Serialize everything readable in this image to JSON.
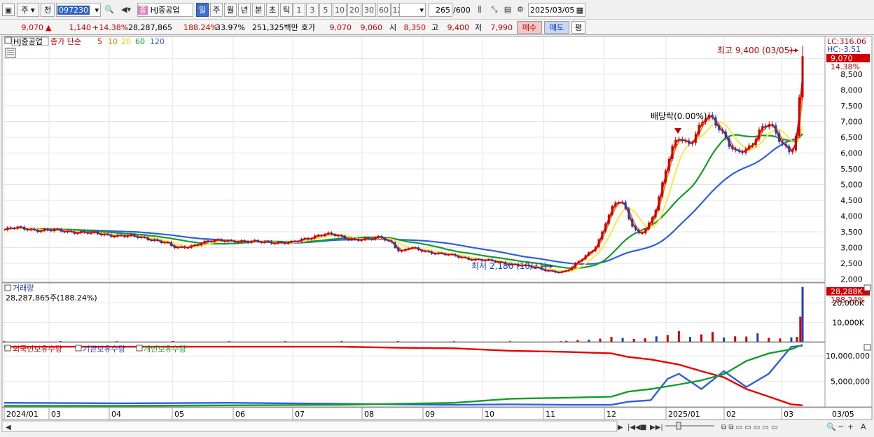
{
  "toolbar": {
    "market_label": "주",
    "prev_label": "전",
    "code": "097230",
    "jong_label": "종",
    "stock_name": "HJ중공업",
    "periods": [
      "일",
      "주",
      "월",
      "년",
      "분",
      "초",
      "틱"
    ],
    "active_period": "일",
    "nums": [
      "1",
      "3",
      "5",
      "10",
      "20",
      "30",
      "60",
      "120"
    ],
    "count": "265",
    "count_max": "/600",
    "date": "2025/03/05"
  },
  "quote": {
    "price": "9,070",
    "arrow": "▲",
    "change": "1,140",
    "change_pct": "+14.38%",
    "volume": "28,287,865",
    "vol_ratio": "188.24%",
    "turnover": "33.97%",
    "amount": "251,325백만",
    "hoga_label": "호가",
    "ask": "9,070",
    "bid": "9,060",
    "open_label": "시",
    "open": "8,350",
    "high_label": "고",
    "high": "9,400",
    "low_label": "저",
    "low": "7,990",
    "buy_label": "매수",
    "sell_label": "매도",
    "avg_label": "평"
  },
  "colors": {
    "up": "#d20000",
    "down": "#1f3dbf",
    "ma5": "#e80000",
    "ma10": "#f08000",
    "ma20": "#f6e84a",
    "ma60": "#169c2a",
    "ma120": "#2f5fe0"
  },
  "chart_data": [
    {
      "type": "candlestick",
      "legend": {
        "name": "HJ중공업",
        "ma_label": "종가 단순",
        "ma_periods": [
          "5",
          "10",
          "20",
          "60",
          "120"
        ]
      },
      "ylim": [
        1900,
        9700
      ],
      "y_ticks": [
        "9,000",
        "8,500",
        "8,000",
        "7,500",
        "7,000",
        "6,500",
        "6,000",
        "5,500",
        "5,000",
        "4,500",
        "4,000",
        "3,500",
        "3,000",
        "2,500",
        "2,000"
      ],
      "y_tick_values": [
        9000,
        8500,
        8000,
        7500,
        7000,
        6500,
        6000,
        5500,
        5000,
        4500,
        4000,
        3500,
        3000,
        2500,
        2000
      ],
      "right_labels": {
        "lc": "LC:316.06",
        "hc": "HC:-3.51",
        "price": "9,070",
        "pct": "14.38%"
      },
      "annotations": {
        "high": "최고 9,400 (03/05)",
        "low": "최저 2,180 (10/31)",
        "dividend": "배당락(0.00%)"
      },
      "high_value": 9400,
      "low_value": 2180,
      "close_series": [
        [
          0,
          3560
        ],
        [
          10,
          3620
        ],
        [
          20,
          3600
        ],
        [
          30,
          3560
        ],
        [
          40,
          3540
        ],
        [
          55,
          3520
        ],
        [
          65,
          3500
        ],
        [
          75,
          3460
        ],
        [
          85,
          3420
        ],
        [
          95,
          3400
        ],
        [
          105,
          3380
        ],
        [
          115,
          3340
        ],
        [
          125,
          3300
        ],
        [
          135,
          3240
        ],
        [
          145,
          3130
        ],
        [
          150,
          3000
        ],
        [
          155,
          2980
        ],
        [
          165,
          3050
        ],
        [
          175,
          3150
        ],
        [
          185,
          3200
        ],
        [
          195,
          3230
        ],
        [
          205,
          3220
        ],
        [
          215,
          3170
        ],
        [
          225,
          3180
        ],
        [
          235,
          3190
        ],
        [
          245,
          3150
        ],
        [
          255,
          3140
        ],
        [
          265,
          3260
        ],
        [
          275,
          3360
        ],
        [
          285,
          3420
        ],
        [
          295,
          3380
        ],
        [
          305,
          3300
        ],
        [
          315,
          3260
        ],
        [
          325,
          3250
        ],
        [
          335,
          3340
        ],
        [
          345,
          3160
        ],
        [
          352,
          2830
        ],
        [
          360,
          2990
        ],
        [
          370,
          2920
        ],
        [
          380,
          2850
        ],
        [
          390,
          2790
        ],
        [
          400,
          2730
        ],
        [
          410,
          2670
        ],
        [
          420,
          2620
        ],
        [
          430,
          2580
        ],
        [
          440,
          2530
        ],
        [
          450,
          2480
        ],
        [
          460,
          2430
        ],
        [
          470,
          2370
        ],
        [
          480,
          2300
        ],
        [
          490,
          2240
        ],
        [
          495,
          2200
        ],
        [
          500,
          2250
        ],
        [
          505,
          2370
        ],
        [
          510,
          2550
        ],
        [
          515,
          2700
        ],
        [
          520,
          2850
        ],
        [
          525,
          3000
        ],
        [
          530,
          3300
        ],
        [
          535,
          3800
        ],
        [
          540,
          4200
        ],
        [
          545,
          4500
        ],
        [
          550,
          4450
        ],
        [
          555,
          4000
        ],
        [
          560,
          3600
        ],
        [
          565,
          3400
        ],
        [
          570,
          3550
        ],
        [
          575,
          3800
        ],
        [
          580,
          4300
        ],
        [
          585,
          5000
        ],
        [
          590,
          5800
        ],
        [
          595,
          6300
        ],
        [
          600,
          6500
        ],
        [
          605,
          6300
        ],
        [
          610,
          6200
        ],
        [
          615,
          6600
        ],
        [
          620,
          7000
        ],
        [
          625,
          7300
        ],
        [
          630,
          7100
        ],
        [
          635,
          6800
        ],
        [
          640,
          6500
        ],
        [
          645,
          6200
        ],
        [
          650,
          6000
        ],
        [
          655,
          6100
        ],
        [
          660,
          6150
        ],
        [
          665,
          6300
        ],
        [
          670,
          6600
        ],
        [
          675,
          6800
        ],
        [
          680,
          6900
        ],
        [
          685,
          6700
        ],
        [
          690,
          6400
        ],
        [
          695,
          6200
        ],
        [
          700,
          6050
        ],
        [
          705,
          6600
        ],
        [
          708,
          8200
        ],
        [
          710,
          9070
        ]
      ]
    },
    {
      "type": "bar",
      "title": "거래량",
      "readout": "28,287,865주(188.24%)",
      "y_ticks": [
        "20,000K",
        "10,000K"
      ],
      "y_tick_values": [
        20000,
        10000
      ],
      "ylim": [
        0,
        30000
      ],
      "right_labels": {
        "value": "28,288K",
        "pct": "188.24%"
      },
      "x_day": [
        0,
        50,
        100,
        150,
        200,
        250,
        300,
        350,
        400,
        450,
        495,
        500,
        510,
        520,
        530,
        540,
        550,
        560,
        570,
        580,
        590,
        600,
        610,
        620,
        630,
        640,
        650,
        660,
        670,
        680,
        690,
        700,
        705,
        708,
        710
      ],
      "values": [
        300,
        350,
        300,
        400,
        300,
        300,
        350,
        400,
        300,
        300,
        300,
        500,
        900,
        1100,
        1600,
        2500,
        2000,
        1500,
        1800,
        2800,
        3500,
        5500,
        2500,
        3800,
        5000,
        2200,
        2800,
        2700,
        4400,
        2000,
        1700,
        2300,
        2500,
        13000,
        28288
      ]
    },
    {
      "type": "line",
      "legend": [
        "외국인보유수량",
        "기관보유수량",
        "개인보유수량"
      ],
      "y_ticks": [
        "10,000,000",
        "5,000,000"
      ],
      "y_tick_values": [
        10000000,
        5000000
      ],
      "ylim": [
        0,
        12500000
      ],
      "x_labels": [
        "2024/01",
        "03",
        "04",
        "05",
        "06",
        "07",
        "08",
        "09",
        "10",
        "11",
        "12",
        "2025/01",
        "02",
        "03",
        "03/05"
      ],
      "series": [
        {
          "name": "외국인보유수량",
          "x": [
            0,
            100,
            200,
            300,
            350,
            400,
            450,
            500,
            540,
            555,
            575,
            600,
            620,
            640,
            660,
            680,
            700,
            710
          ],
          "y": [
            11800000,
            11800000,
            11800000,
            11800000,
            11600000,
            11500000,
            11000000,
            10800000,
            10500000,
            9800000,
            9300000,
            8300000,
            7000000,
            5800000,
            3500000,
            2000000,
            500000,
            300000
          ]
        },
        {
          "name": "기관보유수량",
          "x": [
            0,
            100,
            200,
            300,
            350,
            400,
            450,
            500,
            540,
            555,
            575,
            590,
            600,
            620,
            640,
            660,
            680,
            700,
            710
          ],
          "y": [
            800000,
            700000,
            800000,
            600000,
            500000,
            400000,
            500000,
            400000,
            400000,
            1000000,
            1300000,
            5500000,
            6500000,
            3500000,
            7000000,
            3900000,
            6500000,
            11800000,
            12000000
          ]
        },
        {
          "name": "개인보유수량",
          "x": [
            0,
            100,
            200,
            300,
            350,
            400,
            450,
            500,
            540,
            555,
            575,
            600,
            620,
            640,
            660,
            680,
            700,
            710
          ],
          "y": [
            200000,
            200000,
            300000,
            400000,
            600000,
            800000,
            1600000,
            1800000,
            2000000,
            3000000,
            3500000,
            4400000,
            5200000,
            6400000,
            9000000,
            10500000,
            11300000,
            12200000
          ]
        }
      ]
    }
  ],
  "xaxis": {
    "labels": [
      "2024/01",
      "03",
      "04",
      "05",
      "06",
      "07",
      "08",
      "09",
      "10",
      "11",
      "12",
      "2025/01",
      "02",
      "03",
      "03/05"
    ]
  }
}
